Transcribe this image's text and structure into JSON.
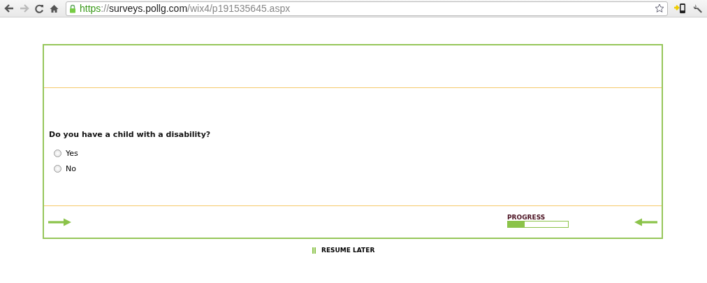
{
  "browser": {
    "url": {
      "scheme": "https",
      "separator": "://",
      "host": "surveys.pollg.com",
      "path": "/wix4/p191535645.aspx"
    }
  },
  "survey": {
    "question": "Do you have a child with a disability?",
    "options": [
      {
        "label": "Yes",
        "selected": false
      },
      {
        "label": "No",
        "selected": false
      }
    ],
    "progress": {
      "label": "PROGRESS",
      "level": 0.28
    },
    "resume_label": "RESUME LATER"
  }
}
